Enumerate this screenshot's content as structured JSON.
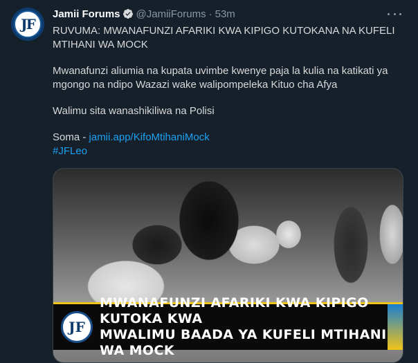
{
  "tweet": {
    "avatar_text": "JF",
    "display_name": "Jamii Forums",
    "handle": "@JamiiForums",
    "separator": "·",
    "time": "53m",
    "title": "RUVUMA: MWANAFUNZI AFARIKI KWA KIPIGO KUTOKANA NA KUFELI MTIHANI WA MOCK",
    "paragraph1": "Mwanafunzi aliumia na kupata uvimbe kwenye paja la kulia na katikati ya mgongo na ndipo Wazazi wake walipompeleka Kituo cha Afya",
    "paragraph2": "Walimu sita wanashikiliwa na Polisi",
    "read_label": "Soma - ",
    "link": "jamii.app/KifoMtihaniMock",
    "hashtag": "#JFLeo"
  },
  "media": {
    "logo_text": "JF",
    "banner_line1": "MWANAFUNZI AFARIKI KWA KIPIGO KUTOKA KWA",
    "banner_line2": "MWALIMU BAADA YA KUFELI MTIHANI WA MOCK"
  },
  "icons": {
    "verified": "verified-badge-icon",
    "more": "more-options-icon"
  },
  "colors": {
    "background": "#15202b",
    "link": "#1da1f2",
    "muted": "#8899a6",
    "banner_accent": "#f0c419"
  }
}
